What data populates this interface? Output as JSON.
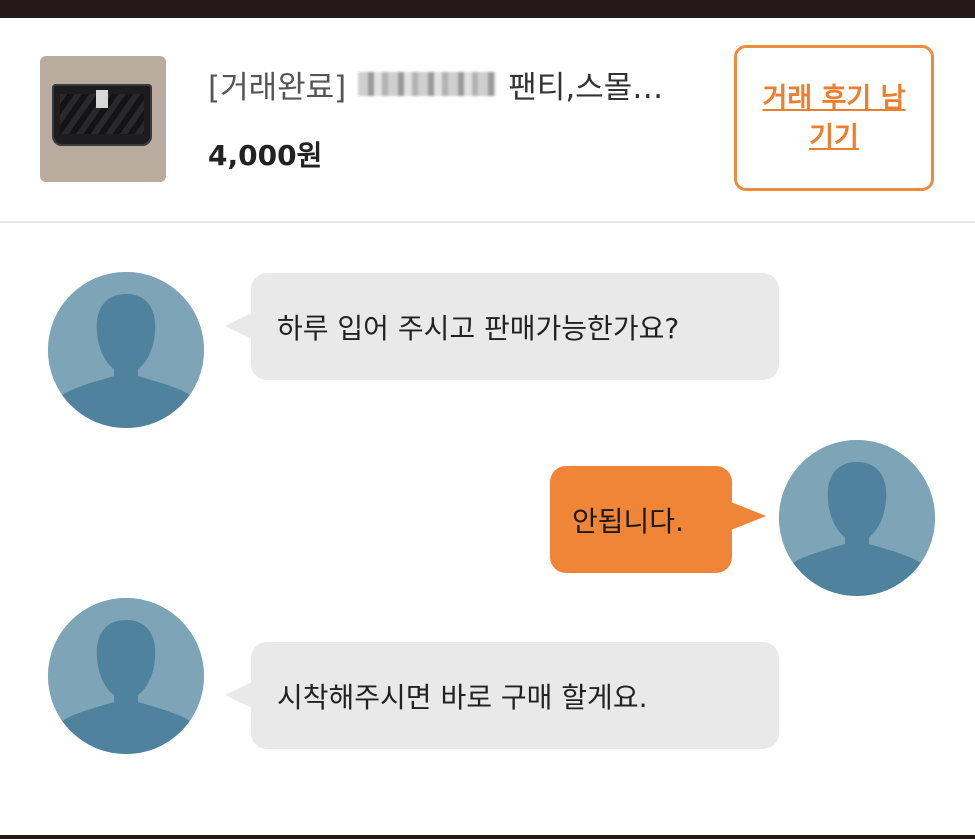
{
  "product": {
    "thumbnail_icon": "product-photo",
    "title_status": "[거래완료]",
    "title_name": "팬티,스몰…",
    "price": "4,000원",
    "review_button_label": "거래 후기 남기기"
  },
  "chat": {
    "messages": [
      {
        "sender": "other",
        "text": "하루 입어 주시고  판매가능한가요?"
      },
      {
        "sender": "me",
        "text": "안됩니다."
      },
      {
        "sender": "other",
        "text": "시착해주시면 바로 구매 할게요."
      }
    ]
  },
  "colors": {
    "accent": "#f08437",
    "button_text": "#ee7d2d",
    "bubble_in": "#e9e9e9",
    "avatar_bg": "#7da4b7",
    "avatar_figure": "#4f829c",
    "top_bar": "#231815"
  },
  "icons": {
    "avatar": "default-user-silhouette"
  }
}
